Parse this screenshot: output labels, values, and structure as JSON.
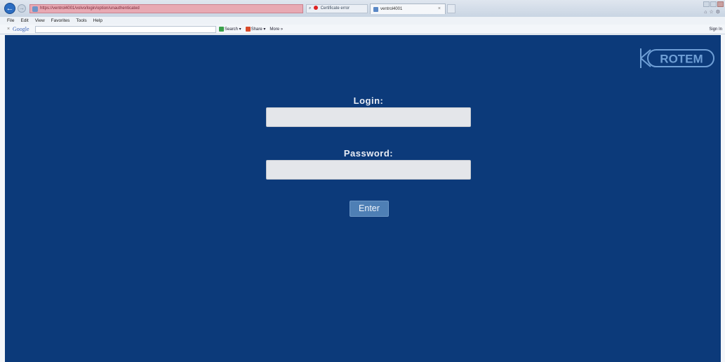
{
  "browser": {
    "address_url": "https://ventrol4001/volvo/login/option/unauthenticated",
    "address_right_text": "Certificate error",
    "tab_title": "ventrol4001",
    "menu": [
      "File",
      "Edit",
      "View",
      "Favorites",
      "Tools",
      "Help"
    ],
    "toolbar": {
      "google_label": "Google",
      "search_label": "Search",
      "share_label": "Share",
      "more_label": "More »",
      "signin_label": "Sign In"
    }
  },
  "page": {
    "background_color": "#0c3a7a",
    "logo_text": "ROTEM",
    "login_label": "Login:",
    "login_value": "",
    "password_label": "Password:",
    "password_value": "",
    "enter_label": "Enter"
  }
}
